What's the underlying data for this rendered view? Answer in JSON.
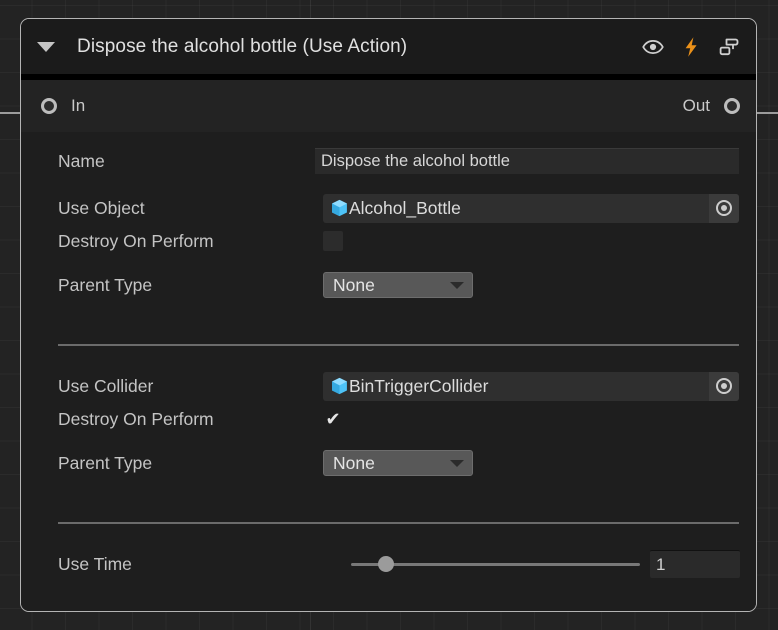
{
  "graph": {
    "background_color": "#232323",
    "grid_line_color": "#2c2c2c"
  },
  "node": {
    "title": "Dispose the alcohol bottle (Use Action)",
    "collapse_arrow": "collapse-triangle-down",
    "border_color": "#b4b4b4",
    "header_color": "#1b1b1b",
    "body_color": "#1e1e1e",
    "header_icons": [
      {
        "name": "eye-icon",
        "tooltip": "Visibility"
      },
      {
        "name": "lightning-bolt-icon",
        "tooltip": "Events",
        "color": "#eb9119"
      },
      {
        "name": "extract-node-icon",
        "tooltip": "Extract"
      }
    ],
    "ports": {
      "in_label": "In",
      "out_label": "Out",
      "port_color": "#bdbdbd"
    },
    "fields": {
      "name": {
        "label": "Name",
        "value": "Dispose the alcohol bottle",
        "placeholder": "Name"
      },
      "use_object": {
        "label": "Use Object",
        "value": "Alcohol_Bottle",
        "icon": "prefab-cube-icon",
        "icon_color": "#4ec3f7",
        "picker": "object-picker-icon"
      },
      "destroy_on_perform_1": {
        "label": "Destroy On Perform",
        "checked": false,
        "check_glyph": "✔"
      },
      "parent_type_1": {
        "label": "Parent Type",
        "value": "None",
        "options": [
          "None"
        ]
      },
      "use_collider": {
        "label": "Use Collider",
        "value": "BinTriggerCollider",
        "icon": "prefab-cube-icon",
        "icon_color": "#4ec3f7",
        "picker": "object-picker-icon"
      },
      "destroy_on_perform_2": {
        "label": "Destroy On Perform",
        "checked": true,
        "check_glyph": "✔"
      },
      "parent_type_2": {
        "label": "Parent Type",
        "value": "None",
        "options": [
          "None"
        ]
      },
      "use_time": {
        "label": "Use Time",
        "value": "1",
        "slider_percent": 12
      }
    }
  }
}
